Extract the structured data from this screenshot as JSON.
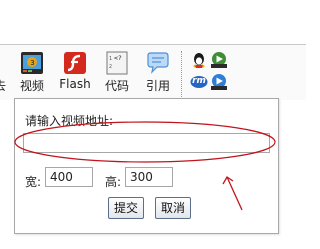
{
  "toolbar": {
    "left_cut_label": "去",
    "buttons": [
      {
        "icon": "video-icon",
        "label": "视频"
      },
      {
        "icon": "flash-icon",
        "label": "Flash"
      },
      {
        "icon": "code-icon",
        "label": "代码",
        "glyph_top": "<?",
        "glyph_n1": "1",
        "glyph_n2": "2"
      },
      {
        "icon": "quote-icon",
        "label": "引用"
      }
    ],
    "media_icons": [
      "qq-icon",
      "realmedia-icon",
      "qq-media-icon",
      "media-player-icon"
    ],
    "rm_text": "rm"
  },
  "dialog": {
    "url_label": "请输入视频地址:",
    "url_value": "",
    "width_label": "宽:",
    "width_value": "400",
    "height_label": "高:",
    "height_value": "300",
    "submit_label": "提交",
    "cancel_label": "取消"
  },
  "colors": {
    "annotation": "#c0141c",
    "flash": "#d42a1d",
    "video": "#e8a417",
    "quote": "#4d8fd8"
  }
}
